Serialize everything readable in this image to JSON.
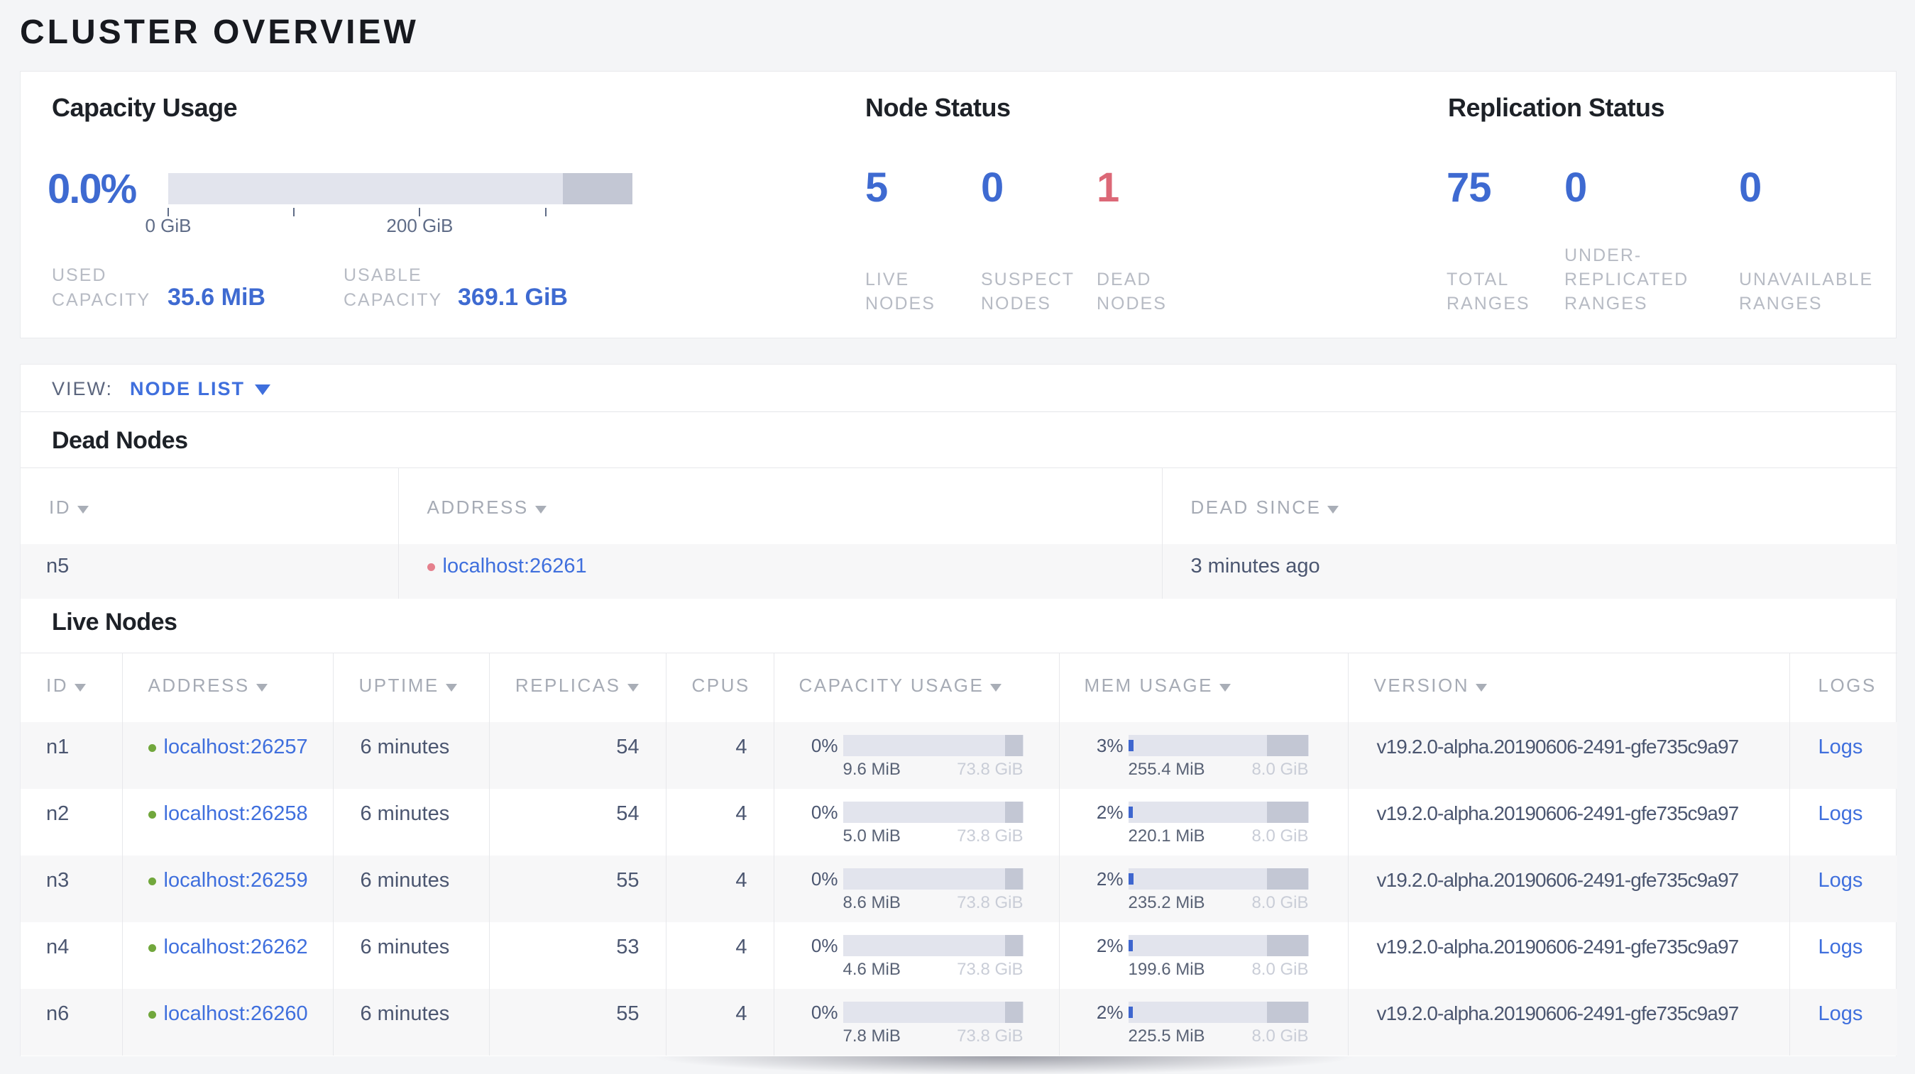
{
  "page_title": "CLUSTER OVERVIEW",
  "colors": {
    "accent_blue": "#3e6ad1",
    "link_blue": "#3f6fdd",
    "dead_red": "#dc6877",
    "live_dot_green": "#71a73c",
    "dead_dot_red": "#e5808d",
    "bar_track": "#e2e4ed",
    "bar_dark": "#c3c7d4",
    "bar_fill": "#3e66cf"
  },
  "overview_card": {
    "capacity": {
      "title": "Capacity Usage",
      "percent": "0.0%",
      "chart": {
        "type": "bar",
        "domain_gib": [
          0,
          369.1
        ],
        "used_frac": 0.0001,
        "dark_from_frac": 0.85,
        "ticks": [
          {
            "value": 0,
            "label": "0 GiB"
          },
          {
            "value": 100,
            "label": ""
          },
          {
            "value": 200,
            "label": "200 GiB"
          },
          {
            "value": 300,
            "label": ""
          }
        ]
      },
      "used_label_lines": [
        "USED",
        "CAPACITY"
      ],
      "used_value": "35.6 MiB",
      "usable_label_lines": [
        "USABLE",
        "CAPACITY"
      ],
      "usable_value": "369.1 GiB"
    },
    "node_status": {
      "title": "Node Status",
      "stats": [
        {
          "value": "5",
          "label_lines": [
            "LIVE",
            "NODES"
          ]
        },
        {
          "value": "0",
          "label_lines": [
            "SUSPECT",
            "NODES"
          ]
        },
        {
          "value": "1",
          "label_lines": [
            "DEAD",
            "NODES"
          ],
          "alert": true
        }
      ]
    },
    "replication_status": {
      "title": "Replication Status",
      "stats": [
        {
          "value": "75",
          "label_lines": [
            "TOTAL",
            "RANGES"
          ]
        },
        {
          "value": "0",
          "label_lines": [
            "UNDER-",
            "REPLICATED",
            "RANGES"
          ]
        },
        {
          "value": "0",
          "label_lines": [
            "UNAVAILABLE",
            "RANGES"
          ]
        }
      ]
    }
  },
  "view_bar": {
    "label": "VIEW:",
    "value": "NODE LIST"
  },
  "dead_nodes": {
    "heading": "Dead Nodes",
    "columns": [
      {
        "label": "ID",
        "sortable": true
      },
      {
        "label": "ADDRESS",
        "sortable": true
      },
      {
        "label": "DEAD SINCE",
        "sortable": true
      }
    ],
    "rows": [
      {
        "id": "n5",
        "address": "localhost:26261",
        "dead_since": "3 minutes ago"
      }
    ]
  },
  "live_nodes": {
    "heading": "Live Nodes",
    "columns": [
      {
        "label": "ID",
        "sortable": true
      },
      {
        "label": "ADDRESS",
        "sortable": true
      },
      {
        "label": "UPTIME",
        "sortable": true
      },
      {
        "label": "REPLICAS",
        "sortable": true
      },
      {
        "label": "CPUS",
        "sortable": false
      },
      {
        "label": "CAPACITY USAGE",
        "sortable": true
      },
      {
        "label": "MEM USAGE",
        "sortable": true
      },
      {
        "label": "VERSION",
        "sortable": true
      },
      {
        "label": "LOGS",
        "sortable": false
      }
    ],
    "rows": [
      {
        "id": "n1",
        "address": "localhost:26257",
        "uptime": "6 minutes",
        "replicas": "54",
        "cpus": "4",
        "capacity": {
          "percent": "0%",
          "used": "9.6 MiB",
          "total": "73.8 GiB",
          "used_frac": 0.0001,
          "dark_from_frac": 0.901
        },
        "memory": {
          "percent": "3%",
          "used": "255.4 MiB",
          "total": "8.0 GiB",
          "used_frac": 0.031,
          "dark_from_frac": 0.768
        },
        "version": "v19.2.0-alpha.20190606-2491-gfe735c9a97",
        "logs_label": "Logs"
      },
      {
        "id": "n2",
        "address": "localhost:26258",
        "uptime": "6 minutes",
        "replicas": "54",
        "cpus": "4",
        "capacity": {
          "percent": "0%",
          "used": "5.0 MiB",
          "total": "73.8 GiB",
          "used_frac": 0.0001,
          "dark_from_frac": 0.901
        },
        "memory": {
          "percent": "2%",
          "used": "220.1 MiB",
          "total": "8.0 GiB",
          "used_frac": 0.0269,
          "dark_from_frac": 0.768
        },
        "version": "v19.2.0-alpha.20190606-2491-gfe735c9a97",
        "logs_label": "Logs"
      },
      {
        "id": "n3",
        "address": "localhost:26259",
        "uptime": "6 minutes",
        "replicas": "55",
        "cpus": "4",
        "capacity": {
          "percent": "0%",
          "used": "8.6 MiB",
          "total": "73.8 GiB",
          "used_frac": 0.0001,
          "dark_from_frac": 0.901
        },
        "memory": {
          "percent": "2%",
          "used": "235.2 MiB",
          "total": "8.0 GiB",
          "used_frac": 0.0287,
          "dark_from_frac": 0.768
        },
        "version": "v19.2.0-alpha.20190606-2491-gfe735c9a97",
        "logs_label": "Logs"
      },
      {
        "id": "n4",
        "address": "localhost:26262",
        "uptime": "6 minutes",
        "replicas": "53",
        "cpus": "4",
        "capacity": {
          "percent": "0%",
          "used": "4.6 MiB",
          "total": "73.8 GiB",
          "used_frac": 0.0001,
          "dark_from_frac": 0.901
        },
        "memory": {
          "percent": "2%",
          "used": "199.6 MiB",
          "total": "8.0 GiB",
          "used_frac": 0.0244,
          "dark_from_frac": 0.768
        },
        "version": "v19.2.0-alpha.20190606-2491-gfe735c9a97",
        "logs_label": "Logs"
      },
      {
        "id": "n6",
        "address": "localhost:26260",
        "uptime": "6 minutes",
        "replicas": "55",
        "cpus": "4",
        "capacity": {
          "percent": "0%",
          "used": "7.8 MiB",
          "total": "73.8 GiB",
          "used_frac": 0.0001,
          "dark_from_frac": 0.901
        },
        "memory": {
          "percent": "2%",
          "used": "225.5 MiB",
          "total": "8.0 GiB",
          "used_frac": 0.0275,
          "dark_from_frac": 0.768
        },
        "version": "v19.2.0-alpha.20190606-2491-gfe735c9a97",
        "logs_label": "Logs"
      }
    ]
  }
}
